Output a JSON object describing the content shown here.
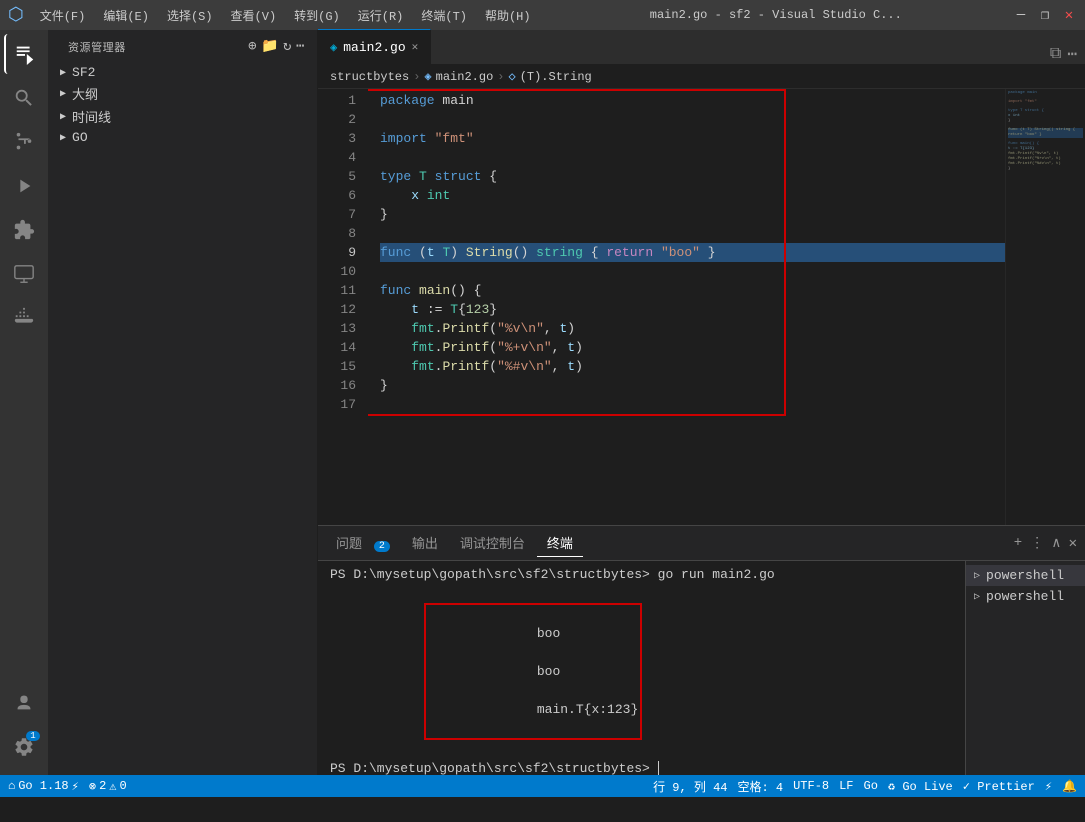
{
  "titlebar": {
    "title": "main2.go - sf2 - Visual Studio C...",
    "vscode_icon": "◉",
    "win_min": "—",
    "win_restore": "❐",
    "win_close": "✕"
  },
  "menubar": {
    "items": [
      "文件(F)",
      "编辑(E)",
      "选择(S)",
      "查看(V)",
      "转到(G)",
      "运行(R)",
      "终端(T)",
      "帮助(H)"
    ]
  },
  "activity": {
    "icons": [
      {
        "name": "explorer",
        "symbol": "⎘",
        "active": true
      },
      {
        "name": "search",
        "symbol": "🔍"
      },
      {
        "name": "source-control",
        "symbol": "⑂"
      },
      {
        "name": "run-debug",
        "symbol": "▷"
      },
      {
        "name": "extensions",
        "symbol": "⊞"
      },
      {
        "name": "remote-explorer",
        "symbol": "🖥"
      },
      {
        "name": "docker",
        "symbol": "🐳"
      }
    ],
    "bottom_icons": [
      {
        "name": "account",
        "symbol": "👤"
      },
      {
        "name": "settings",
        "symbol": "⚙",
        "badge": "1"
      }
    ]
  },
  "sidebar": {
    "header": "资源管理器",
    "trees": [
      {
        "label": "SF2",
        "arrow": "▶"
      },
      {
        "label": "大纲",
        "arrow": "▶"
      },
      {
        "label": "时间线",
        "arrow": "▶"
      },
      {
        "label": "GO",
        "arrow": "▶"
      }
    ]
  },
  "tabs": [
    {
      "label": "main2.go",
      "active": true,
      "icon": "◈"
    }
  ],
  "breadcrumb": {
    "items": [
      "structbytes",
      "main2.go",
      "(T).String"
    ]
  },
  "code": {
    "lines": [
      {
        "n": 1,
        "tokens": [
          {
            "t": "kw",
            "v": "package"
          },
          {
            "t": "plain",
            "v": " main"
          }
        ]
      },
      {
        "n": 2,
        "tokens": []
      },
      {
        "n": 3,
        "tokens": [
          {
            "t": "kw",
            "v": "import"
          },
          {
            "t": "plain",
            "v": " "
          },
          {
            "t": "str",
            "v": "\"fmt\""
          }
        ]
      },
      {
        "n": 4,
        "tokens": []
      },
      {
        "n": 5,
        "tokens": [
          {
            "t": "kw",
            "v": "type"
          },
          {
            "t": "plain",
            "v": " "
          },
          {
            "t": "type",
            "v": "T"
          },
          {
            "t": "plain",
            "v": " "
          },
          {
            "t": "kw",
            "v": "struct"
          },
          {
            "t": "plain",
            "v": " {"
          }
        ]
      },
      {
        "n": 6,
        "tokens": [
          {
            "t": "plain",
            "v": "    "
          },
          {
            "t": "var",
            "v": "x"
          },
          {
            "t": "plain",
            "v": " "
          },
          {
            "t": "type",
            "v": "int"
          }
        ]
      },
      {
        "n": 7,
        "tokens": [
          {
            "t": "plain",
            "v": "}"
          }
        ]
      },
      {
        "n": 8,
        "tokens": []
      },
      {
        "n": 9,
        "tokens": [
          {
            "t": "kw",
            "v": "func"
          },
          {
            "t": "plain",
            "v": " ("
          },
          {
            "t": "var",
            "v": "t"
          },
          {
            "t": "plain",
            "v": " "
          },
          {
            "t": "type",
            "v": "T"
          },
          {
            "t": "plain",
            "v": ") "
          },
          {
            "t": "fn",
            "v": "String"
          },
          {
            "t": "plain",
            "v": "() "
          },
          {
            "t": "type",
            "v": "string"
          },
          {
            "t": "plain",
            "v": " { "
          },
          {
            "t": "kw2",
            "v": "return"
          },
          {
            "t": "plain",
            "v": " "
          },
          {
            "t": "str",
            "v": "\"boo\""
          },
          {
            "t": "plain",
            "v": " }"
          }
        ]
      },
      {
        "n": 10,
        "tokens": []
      },
      {
        "n": 11,
        "tokens": [
          {
            "t": "kw",
            "v": "func"
          },
          {
            "t": "plain",
            "v": " "
          },
          {
            "t": "fn",
            "v": "main"
          },
          {
            "t": "plain",
            "v": "() {"
          }
        ]
      },
      {
        "n": 12,
        "tokens": [
          {
            "t": "plain",
            "v": "    "
          },
          {
            "t": "var",
            "v": "t"
          },
          {
            "t": "plain",
            "v": " := "
          },
          {
            "t": "type",
            "v": "T"
          },
          {
            "t": "plain",
            "v": "{"
          },
          {
            "t": "num",
            "v": "123"
          },
          {
            "t": "plain",
            "v": "}"
          }
        ]
      },
      {
        "n": 13,
        "tokens": [
          {
            "t": "plain",
            "v": "    "
          },
          {
            "t": "pkg",
            "v": "fmt"
          },
          {
            "t": "plain",
            "v": "."
          },
          {
            "t": "fn",
            "v": "Printf"
          },
          {
            "t": "plain",
            "v": "("
          },
          {
            "t": "str",
            "v": "\"%v\\n\""
          },
          {
            "t": "plain",
            "v": ", "
          },
          {
            "t": "var",
            "v": "t"
          },
          {
            "t": "plain",
            "v": ")"
          }
        ]
      },
      {
        "n": 14,
        "tokens": [
          {
            "t": "plain",
            "v": "    "
          },
          {
            "t": "pkg",
            "v": "fmt"
          },
          {
            "t": "plain",
            "v": "."
          },
          {
            "t": "fn",
            "v": "Printf"
          },
          {
            "t": "plain",
            "v": "("
          },
          {
            "t": "str",
            "v": "\"%+v\\n\""
          },
          {
            "t": "plain",
            "v": ", "
          },
          {
            "t": "var",
            "v": "t"
          },
          {
            "t": "plain",
            "v": ")"
          }
        ]
      },
      {
        "n": 15,
        "tokens": [
          {
            "t": "plain",
            "v": "    "
          },
          {
            "t": "pkg",
            "v": "fmt"
          },
          {
            "t": "plain",
            "v": "."
          },
          {
            "t": "fn",
            "v": "Printf"
          },
          {
            "t": "plain",
            "v": "("
          },
          {
            "t": "str",
            "v": "\"%#v\\n\""
          },
          {
            "t": "plain",
            "v": ", "
          },
          {
            "t": "var",
            "v": "t"
          },
          {
            "t": "plain",
            "v": ")"
          }
        ]
      },
      {
        "n": 16,
        "tokens": [
          {
            "t": "plain",
            "v": "}"
          }
        ]
      },
      {
        "n": 17,
        "tokens": []
      }
    ]
  },
  "panel": {
    "tabs": [
      {
        "label": "问题",
        "badge": "2"
      },
      {
        "label": "输出"
      },
      {
        "label": "调试控制台"
      },
      {
        "label": "终端",
        "active": true
      }
    ],
    "terminal_lines": [
      {
        "type": "cmd",
        "text": "PS D:\\mysetup\\gopath\\src\\sf2\\structbytes> go run main2.go"
      },
      {
        "type": "output",
        "text": "boo",
        "highlighted": true
      },
      {
        "type": "output",
        "text": "boo",
        "highlighted": true
      },
      {
        "type": "output",
        "text": "main.T{x:123}",
        "highlighted": true
      },
      {
        "type": "prompt",
        "text": "PS D:\\mysetup\\gopath\\src\\sf2\\structbytes> "
      }
    ],
    "sidebar_items": [
      {
        "label": "powershell"
      },
      {
        "label": "powershell"
      }
    ]
  },
  "statusbar": {
    "left": [
      {
        "text": "⌂ Go 1.18",
        "name": "remote-indicator"
      },
      {
        "text": "⊗ 2  ⚠ 0",
        "name": "errors-warnings"
      }
    ],
    "right": [
      {
        "text": "行 9, 列 44",
        "name": "cursor-position"
      },
      {
        "text": "空格: 4",
        "name": "indent"
      },
      {
        "text": "UTF-8",
        "name": "encoding"
      },
      {
        "text": "LF",
        "name": "line-ending"
      },
      {
        "text": "Go",
        "name": "language-mode"
      },
      {
        "text": "♻ Go Live",
        "name": "go-live"
      },
      {
        "text": "✓ Prettier",
        "name": "prettier"
      },
      {
        "text": "⚡",
        "name": "format-icon"
      },
      {
        "text": "🔔",
        "name": "notifications"
      }
    ]
  }
}
